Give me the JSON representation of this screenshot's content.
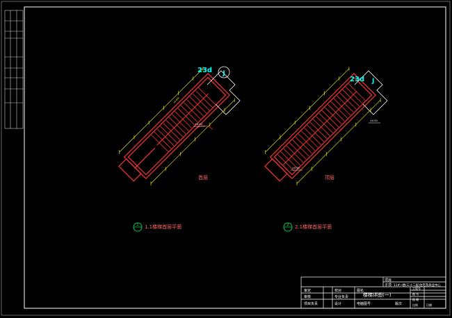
{
  "view_labels": {
    "first_floor": "首层",
    "top_floor": "顶层"
  },
  "axis_tags": {
    "left": {
      "number": "23d",
      "letter": "J"
    },
    "right": {
      "number": "23d",
      "letter": "J"
    }
  },
  "captions": [
    {
      "num": "1",
      "text": "1.1楼梯首层平面"
    },
    {
      "num": "2",
      "text": "2.1楼梯首层平面"
    }
  ],
  "title_block": {
    "project_label": "项目",
    "subproject_label": "子项",
    "subproject_value": "11#~楼(三十二层)住宅及商业中心",
    "review": "审定",
    "audit": "审核",
    "project_lead": "项目负责",
    "check": "校对",
    "discipline_lead": "专业负责",
    "design": "设计",
    "drawing_name_label": "图名",
    "drawing_name": "楼梯详图(一)",
    "file_number": "电脑图号",
    "version": "版次",
    "right_col": [
      "工程号",
      "图 号",
      "图 期",
      "比例",
      "日期"
    ]
  },
  "colors": {
    "wall": "#ff3333",
    "dim": "#ffff00",
    "label": "#00ffff",
    "caption_circle": "#00ff66",
    "frame": "#ffffff"
  }
}
